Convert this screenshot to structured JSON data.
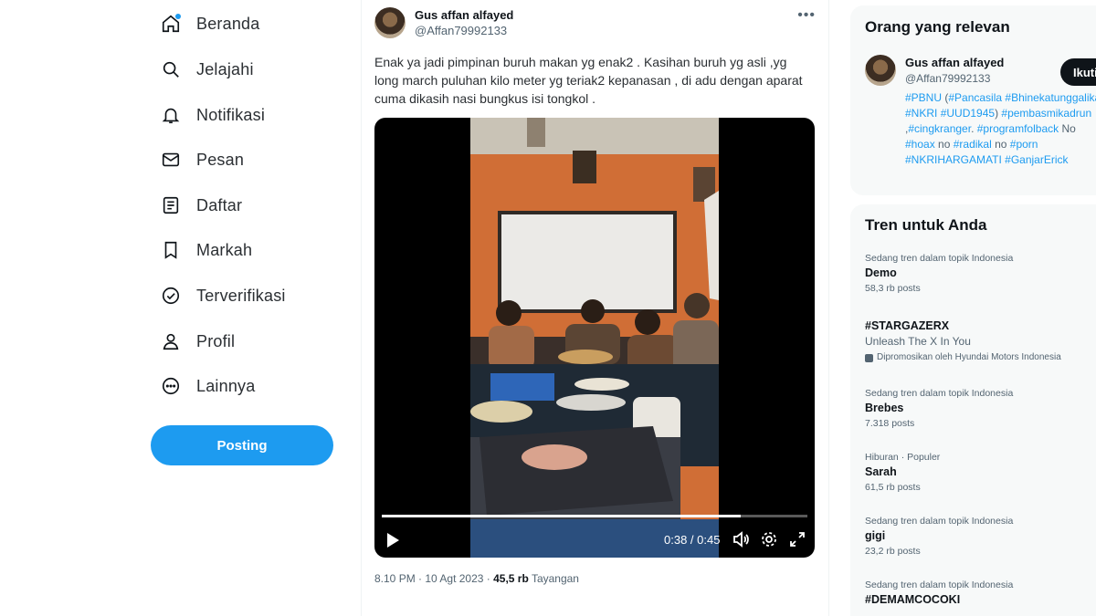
{
  "nav": {
    "items": [
      {
        "label": "Beranda",
        "icon": "home-icon"
      },
      {
        "label": "Jelajahi",
        "icon": "search-icon"
      },
      {
        "label": "Notifikasi",
        "icon": "bell-icon"
      },
      {
        "label": "Pesan",
        "icon": "mail-icon"
      },
      {
        "label": "Daftar",
        "icon": "list-icon"
      },
      {
        "label": "Markah",
        "icon": "bookmark-icon"
      },
      {
        "label": "Terverifikasi",
        "icon": "verified-icon"
      },
      {
        "label": "Profil",
        "icon": "person-icon"
      },
      {
        "label": "Lainnya",
        "icon": "more-circle-icon"
      }
    ],
    "post_label": "Posting"
  },
  "tweet": {
    "author_name": "Gus affan alfayed",
    "author_handle": "@Affan79992133",
    "text": "Enak ya jadi pimpinan buruh makan yg enak2 . Kasihan buruh yg asli ,yg long march puluhan kilo meter yg teriak2 kepanasan , di adu dengan aparat  cuma dikasih nasi bungkus isi tongkol .",
    "video": {
      "time": "0:38 / 0:45",
      "progress": 0.844
    },
    "meta": {
      "time": "8.10 PM",
      "date": "10 Agt 2023",
      "views": "45,5 rb",
      "views_label": "Tayangan"
    }
  },
  "relevant": {
    "title": "Orang yang relevan",
    "name": "Gus affan alfayed",
    "handle": "@Affan79992133",
    "follow_label": "Ikuti",
    "bio": [
      {
        "t": "#PBNU",
        "tag": true
      },
      {
        "t": " (",
        "tag": false
      },
      {
        "t": "#Pancasila",
        "tag": true
      },
      {
        "t": " ",
        "tag": false
      },
      {
        "t": "#Bhinekatunggalika",
        "tag": true
      },
      {
        "t": " ",
        "tag": false
      },
      {
        "t": "#NKRI",
        "tag": true
      },
      {
        "t": " ",
        "tag": false
      },
      {
        "t": "#UUD1945",
        "tag": true
      },
      {
        "t": ") ",
        "tag": false
      },
      {
        "t": "#pembasmikadrun",
        "tag": true
      },
      {
        "t": " ,",
        "tag": false
      },
      {
        "t": "#cingkranger",
        "tag": true
      },
      {
        "t": ". ",
        "tag": false
      },
      {
        "t": "#programfolback",
        "tag": true
      },
      {
        "t": " No ",
        "tag": false
      },
      {
        "t": "#hoax",
        "tag": true
      },
      {
        "t": " no ",
        "tag": false
      },
      {
        "t": "#radikal",
        "tag": true
      },
      {
        "t": " no ",
        "tag": false
      },
      {
        "t": "#porn",
        "tag": true
      },
      {
        "t": " ",
        "tag": false
      },
      {
        "t": "#NKRIHARGAMATI",
        "tag": true
      },
      {
        "t": " ",
        "tag": false
      },
      {
        "t": "#GanjarErick",
        "tag": true
      }
    ]
  },
  "trends": {
    "title": "Tren untuk Anda",
    "items": [
      {
        "context": "Sedang tren dalam topik Indonesia",
        "name": "Demo",
        "count": "58,3 rb posts"
      },
      {
        "context": "",
        "name": "#STARGAZERX",
        "desc": "Unleash The X In You",
        "promo": "Dipromosikan oleh Hyundai Motors Indonesia"
      },
      {
        "context": "Sedang tren dalam topik Indonesia",
        "name": "Brebes",
        "count": "7.318 posts"
      },
      {
        "context": "Hiburan · Populer",
        "name": "Sarah",
        "count": "61,5 rb posts"
      },
      {
        "context": "Sedang tren dalam topik Indonesia",
        "name": "gigi",
        "count": "23,2 rb posts"
      },
      {
        "context": "Sedang tren dalam topik Indonesia",
        "name": "#DEMAMCOCOKI",
        "count": ""
      }
    ]
  }
}
